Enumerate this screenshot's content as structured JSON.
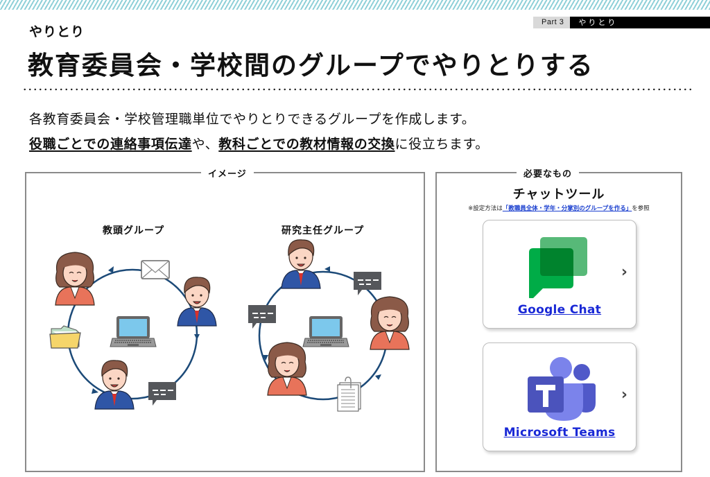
{
  "header": {
    "part_number": "Part 3",
    "part_name": "やりとり",
    "section_label": "やりとり",
    "title": "教育委員会・学校間のグループでやりとりする"
  },
  "description": {
    "line1": "各教育委員会・学校管理職単位でやりとりできるグループを作成します。",
    "line2_segments": {
      "emph1": "役職ごとでの連絡事項伝達",
      "mid": "や、",
      "emph2": "教科ごとでの教材情報の交換",
      "tail": "に役立ちます。"
    }
  },
  "image_panel": {
    "legend": "イメージ",
    "groups": [
      {
        "title": "教頭グループ",
        "members": [
          "woman",
          "man",
          "man"
        ],
        "items": [
          "envelope-icon",
          "chat-bubble-icon",
          "folder-icon"
        ],
        "center": "laptop-icon"
      },
      {
        "title": "研究主任グループ",
        "members": [
          "man",
          "woman",
          "woman"
        ],
        "items": [
          "chat-bubble-icon",
          "documents-icon",
          "chat-bubble-icon"
        ],
        "center": "laptop-icon"
      }
    ]
  },
  "needs_panel": {
    "legend": "必要なもの",
    "title": "チャットツール",
    "note_prefix": "※設定方法は",
    "note_link": "「教職員全体・学年・分掌別のグループを作る」",
    "note_suffix": "を参照",
    "apps": [
      {
        "name": "Google Chat",
        "icon": "google-chat-icon"
      },
      {
        "name": "Microsoft Teams",
        "icon": "microsoft-teams-icon"
      }
    ]
  },
  "colors": {
    "stripe": "#8fd0d8",
    "link": "#1a29d6",
    "circle_line": "#1c4a78",
    "google_green": "#00ac47",
    "teams_purple": "#5059c9"
  }
}
